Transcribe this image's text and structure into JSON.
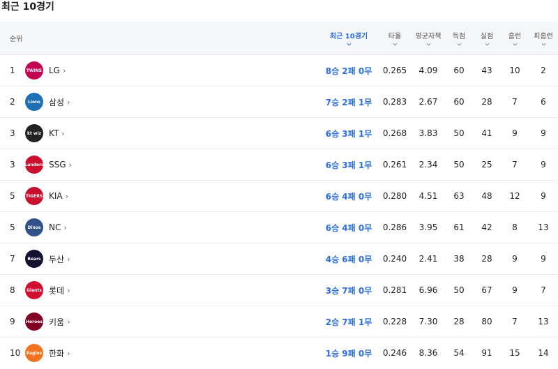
{
  "title": "최근 10경기",
  "headers": {
    "rank": "순위",
    "recent": "최근 10경기",
    "avg": "타율",
    "era": "평균자책",
    "runs": "득점",
    "ra": "실점",
    "hr": "홈런",
    "hra": "피홈런"
  },
  "arrow": "›",
  "rows": [
    {
      "rank": "1",
      "team": "LG",
      "logo": "TWINS",
      "logo_color": "#c30452",
      "recent": "8승 2패 0무",
      "avg": "0.265",
      "era": "4.09",
      "runs": "60",
      "ra": "43",
      "hr": "10",
      "hra": "2"
    },
    {
      "rank": "2",
      "team": "삼성",
      "logo": "Lions",
      "logo_color": "#1f6fb5",
      "recent": "7승 2패 1무",
      "avg": "0.283",
      "era": "2.67",
      "runs": "60",
      "ra": "28",
      "hr": "7",
      "hra": "6"
    },
    {
      "rank": "3",
      "team": "KT",
      "logo": "kt wiz",
      "logo_color": "#222222",
      "recent": "6승 3패 1무",
      "avg": "0.268",
      "era": "3.83",
      "runs": "50",
      "ra": "41",
      "hr": "9",
      "hra": "9"
    },
    {
      "rank": "3",
      "team": "SSG",
      "logo": "Landers",
      "logo_color": "#ce0e2d",
      "recent": "6승 3패 1무",
      "avg": "0.261",
      "era": "2.34",
      "runs": "50",
      "ra": "25",
      "hr": "7",
      "hra": "9"
    },
    {
      "rank": "5",
      "team": "KIA",
      "logo": "TIGERS",
      "logo_color": "#c8102e",
      "recent": "6승 4패 0무",
      "avg": "0.280",
      "era": "4.51",
      "runs": "63",
      "ra": "48",
      "hr": "12",
      "hra": "9"
    },
    {
      "rank": "5",
      "team": "NC",
      "logo": "Dinos",
      "logo_color": "#315288",
      "recent": "6승 4패 0무",
      "avg": "0.286",
      "era": "3.95",
      "runs": "61",
      "ra": "42",
      "hr": "8",
      "hra": "13"
    },
    {
      "rank": "7",
      "team": "두산",
      "logo": "Bears",
      "logo_color": "#131230",
      "recent": "4승 6패 0무",
      "avg": "0.240",
      "era": "2.41",
      "runs": "38",
      "ra": "28",
      "hr": "9",
      "hra": "9"
    },
    {
      "rank": "8",
      "team": "롯데",
      "logo": "Giants",
      "logo_color": "#d00f31",
      "recent": "3승 7패 0무",
      "avg": "0.281",
      "era": "6.96",
      "runs": "50",
      "ra": "67",
      "hr": "9",
      "hra": "7"
    },
    {
      "rank": "9",
      "team": "키움",
      "logo": "Heroes",
      "logo_color": "#820024",
      "recent": "2승 7패 1무",
      "avg": "0.228",
      "era": "7.30",
      "runs": "28",
      "ra": "80",
      "hr": "7",
      "hra": "13"
    },
    {
      "rank": "10",
      "team": "한화",
      "logo": "Eagles",
      "logo_color": "#f37321",
      "recent": "1승 9패 0무",
      "avg": "0.246",
      "era": "8.36",
      "runs": "54",
      "ra": "91",
      "hr": "15",
      "hra": "14"
    }
  ]
}
